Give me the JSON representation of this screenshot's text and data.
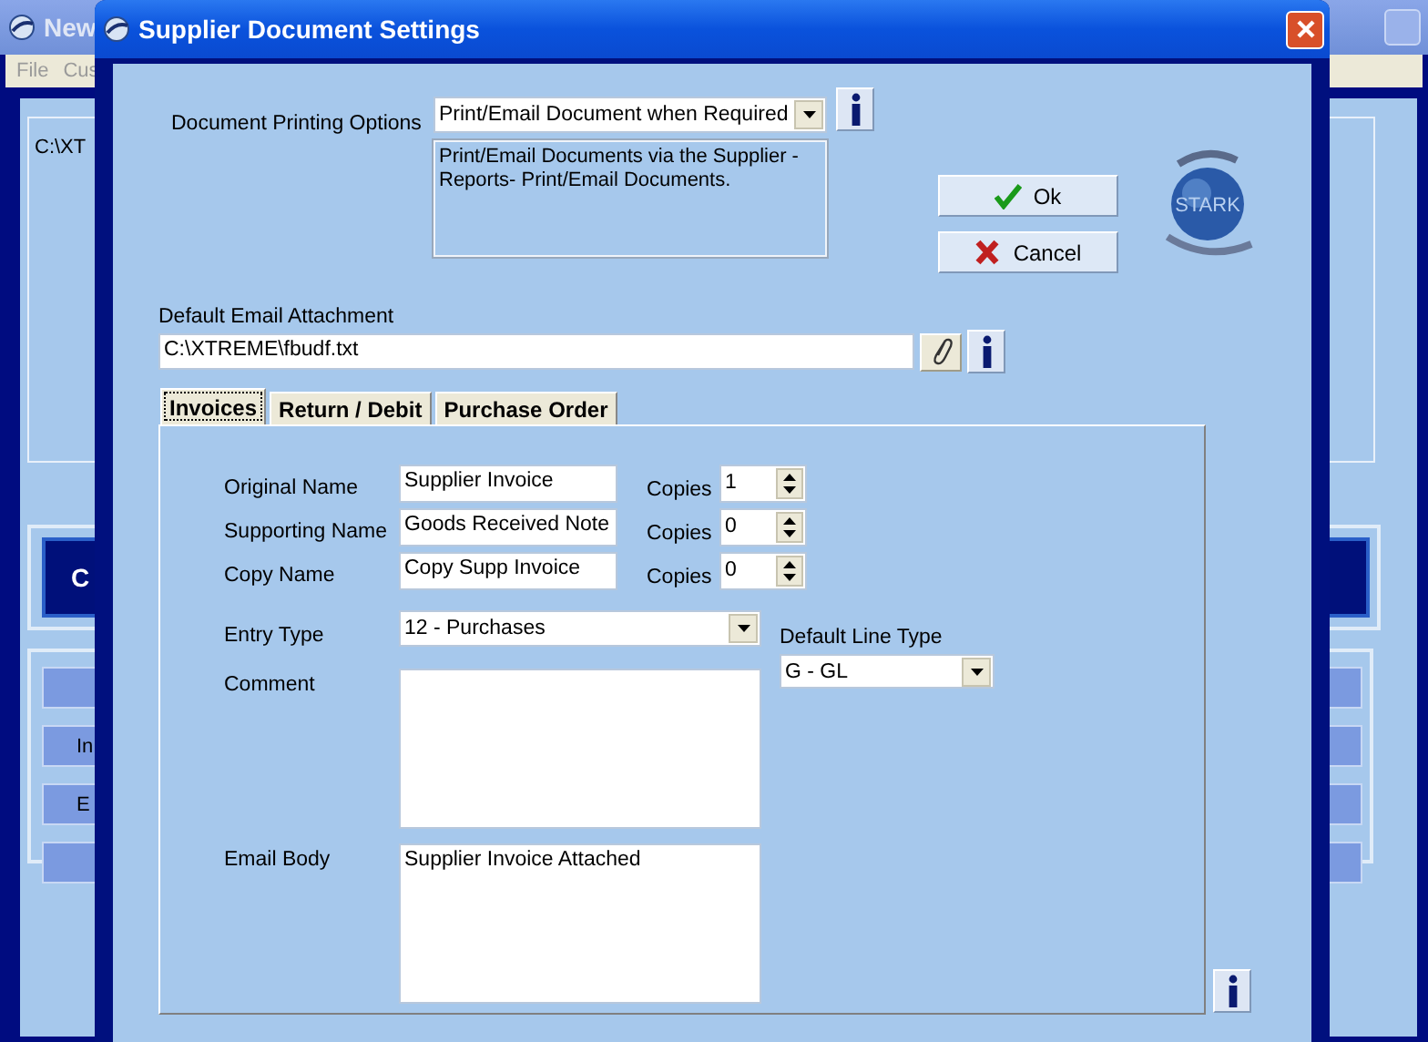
{
  "background_window": {
    "title": "New",
    "menu": [
      "File",
      "Cus"
    ],
    "path": "C:\\XT",
    "buttons": [
      {
        "kind": "dark",
        "label": "C"
      },
      {
        "kind": "plain"
      },
      {
        "kind": "plain",
        "label": "In"
      },
      {
        "kind": "plain",
        "label": "E"
      },
      {
        "kind": "plain"
      }
    ]
  },
  "dialog": {
    "title": "Supplier Document Settings",
    "printing_options": {
      "label": "Document Printing Options",
      "value": "Print/Email Document when Required",
      "description": "Print/Email Documents via the Supplier - Reports- Print/Email Documents."
    },
    "buttons": [
      {
        "kind": "ok",
        "label": "Ok"
      },
      {
        "kind": "cancel",
        "label": "Cancel"
      }
    ],
    "logo_text": "STARK",
    "attachment": {
      "label": "Default Email Attachment",
      "value": "C:\\XTREME\\fbudf.txt"
    },
    "tabs": [
      {
        "label": "Invoices",
        "selected": true
      },
      {
        "label": "Return / Debit",
        "selected": false
      },
      {
        "label": "Purchase Order",
        "selected": false
      }
    ],
    "names": [
      {
        "label": "Original Name",
        "value": "Supplier Invoice",
        "copies_label": "Copies",
        "copies": "1"
      },
      {
        "label": "Supporting Name",
        "value": "Goods Received Note",
        "copies_label": "Copies",
        "copies": "0"
      },
      {
        "label": "Copy Name",
        "value": "Copy Supp Invoice",
        "copies_label": "Copies",
        "copies": "0"
      }
    ],
    "entry_type": {
      "label": "Entry Type",
      "value": "12 - Purchases"
    },
    "default_line_type": {
      "label": "Default Line Type",
      "value": "G - GL"
    },
    "comment": {
      "label": "Comment"
    },
    "email_body": {
      "label": "Email Body",
      "value": "Supplier Invoice Attached"
    }
  }
}
